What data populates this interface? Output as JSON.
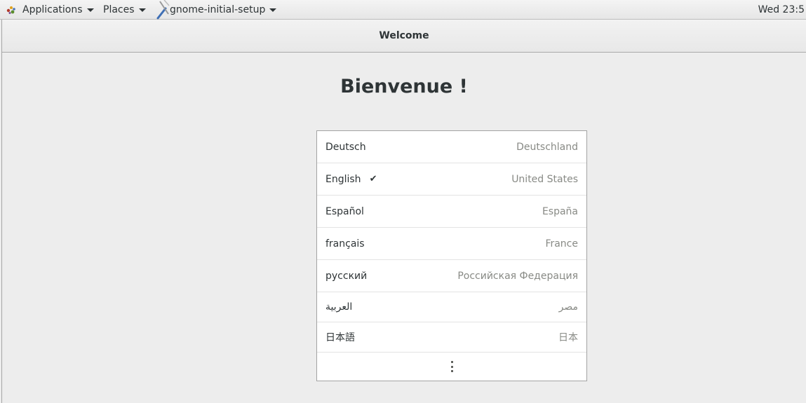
{
  "top_panel": {
    "applications_label": "Applications",
    "places_label": "Places",
    "window_label": "gnome-initial-setup",
    "clock": "Wed 23:5"
  },
  "window": {
    "title": "Welcome",
    "heading": "Bienvenue !"
  },
  "languages": [
    {
      "name": "Deutsch",
      "region": "Deutschland",
      "selected": false
    },
    {
      "name": "English",
      "region": "United States",
      "selected": true
    },
    {
      "name": "Español",
      "region": "España",
      "selected": false
    },
    {
      "name": "français",
      "region": "France",
      "selected": false
    },
    {
      "name": "русский",
      "region": "Российская Федерация",
      "selected": false
    },
    {
      "name": "العربية",
      "region": "مصر",
      "selected": false
    },
    {
      "name": "日本語",
      "region": "日本",
      "selected": false
    }
  ],
  "selected_check_glyph": "✔",
  "icons": {
    "apps_logo": "gnome-foot-icon",
    "window_app": "tools-icon",
    "more": "view-more-icon"
  }
}
